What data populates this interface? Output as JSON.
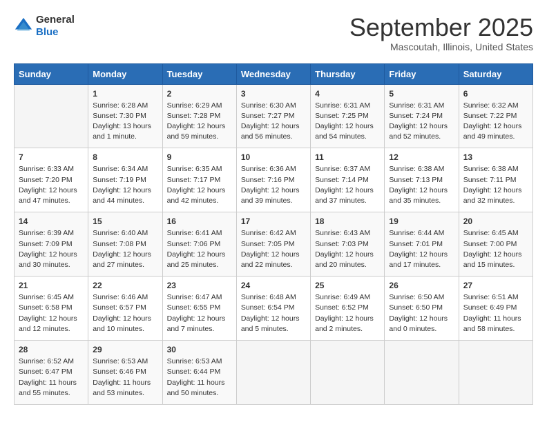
{
  "header": {
    "logo_general": "General",
    "logo_blue": "Blue",
    "month_title": "September 2025",
    "location": "Mascoutah, Illinois, United States"
  },
  "days_of_week": [
    "Sunday",
    "Monday",
    "Tuesday",
    "Wednesday",
    "Thursday",
    "Friday",
    "Saturday"
  ],
  "weeks": [
    [
      {
        "num": "",
        "info": ""
      },
      {
        "num": "1",
        "info": "Sunrise: 6:28 AM\nSunset: 7:30 PM\nDaylight: 13 hours\nand 1 minute."
      },
      {
        "num": "2",
        "info": "Sunrise: 6:29 AM\nSunset: 7:28 PM\nDaylight: 12 hours\nand 59 minutes."
      },
      {
        "num": "3",
        "info": "Sunrise: 6:30 AM\nSunset: 7:27 PM\nDaylight: 12 hours\nand 56 minutes."
      },
      {
        "num": "4",
        "info": "Sunrise: 6:31 AM\nSunset: 7:25 PM\nDaylight: 12 hours\nand 54 minutes."
      },
      {
        "num": "5",
        "info": "Sunrise: 6:31 AM\nSunset: 7:24 PM\nDaylight: 12 hours\nand 52 minutes."
      },
      {
        "num": "6",
        "info": "Sunrise: 6:32 AM\nSunset: 7:22 PM\nDaylight: 12 hours\nand 49 minutes."
      }
    ],
    [
      {
        "num": "7",
        "info": "Sunrise: 6:33 AM\nSunset: 7:20 PM\nDaylight: 12 hours\nand 47 minutes."
      },
      {
        "num": "8",
        "info": "Sunrise: 6:34 AM\nSunset: 7:19 PM\nDaylight: 12 hours\nand 44 minutes."
      },
      {
        "num": "9",
        "info": "Sunrise: 6:35 AM\nSunset: 7:17 PM\nDaylight: 12 hours\nand 42 minutes."
      },
      {
        "num": "10",
        "info": "Sunrise: 6:36 AM\nSunset: 7:16 PM\nDaylight: 12 hours\nand 39 minutes."
      },
      {
        "num": "11",
        "info": "Sunrise: 6:37 AM\nSunset: 7:14 PM\nDaylight: 12 hours\nand 37 minutes."
      },
      {
        "num": "12",
        "info": "Sunrise: 6:38 AM\nSunset: 7:13 PM\nDaylight: 12 hours\nand 35 minutes."
      },
      {
        "num": "13",
        "info": "Sunrise: 6:38 AM\nSunset: 7:11 PM\nDaylight: 12 hours\nand 32 minutes."
      }
    ],
    [
      {
        "num": "14",
        "info": "Sunrise: 6:39 AM\nSunset: 7:09 PM\nDaylight: 12 hours\nand 30 minutes."
      },
      {
        "num": "15",
        "info": "Sunrise: 6:40 AM\nSunset: 7:08 PM\nDaylight: 12 hours\nand 27 minutes."
      },
      {
        "num": "16",
        "info": "Sunrise: 6:41 AM\nSunset: 7:06 PM\nDaylight: 12 hours\nand 25 minutes."
      },
      {
        "num": "17",
        "info": "Sunrise: 6:42 AM\nSunset: 7:05 PM\nDaylight: 12 hours\nand 22 minutes."
      },
      {
        "num": "18",
        "info": "Sunrise: 6:43 AM\nSunset: 7:03 PM\nDaylight: 12 hours\nand 20 minutes."
      },
      {
        "num": "19",
        "info": "Sunrise: 6:44 AM\nSunset: 7:01 PM\nDaylight: 12 hours\nand 17 minutes."
      },
      {
        "num": "20",
        "info": "Sunrise: 6:45 AM\nSunset: 7:00 PM\nDaylight: 12 hours\nand 15 minutes."
      }
    ],
    [
      {
        "num": "21",
        "info": "Sunrise: 6:45 AM\nSunset: 6:58 PM\nDaylight: 12 hours\nand 12 minutes."
      },
      {
        "num": "22",
        "info": "Sunrise: 6:46 AM\nSunset: 6:57 PM\nDaylight: 12 hours\nand 10 minutes."
      },
      {
        "num": "23",
        "info": "Sunrise: 6:47 AM\nSunset: 6:55 PM\nDaylight: 12 hours\nand 7 minutes."
      },
      {
        "num": "24",
        "info": "Sunrise: 6:48 AM\nSunset: 6:54 PM\nDaylight: 12 hours\nand 5 minutes."
      },
      {
        "num": "25",
        "info": "Sunrise: 6:49 AM\nSunset: 6:52 PM\nDaylight: 12 hours\nand 2 minutes."
      },
      {
        "num": "26",
        "info": "Sunrise: 6:50 AM\nSunset: 6:50 PM\nDaylight: 12 hours\nand 0 minutes."
      },
      {
        "num": "27",
        "info": "Sunrise: 6:51 AM\nSunset: 6:49 PM\nDaylight: 11 hours\nand 58 minutes."
      }
    ],
    [
      {
        "num": "28",
        "info": "Sunrise: 6:52 AM\nSunset: 6:47 PM\nDaylight: 11 hours\nand 55 minutes."
      },
      {
        "num": "29",
        "info": "Sunrise: 6:53 AM\nSunset: 6:46 PM\nDaylight: 11 hours\nand 53 minutes."
      },
      {
        "num": "30",
        "info": "Sunrise: 6:53 AM\nSunset: 6:44 PM\nDaylight: 11 hours\nand 50 minutes."
      },
      {
        "num": "",
        "info": ""
      },
      {
        "num": "",
        "info": ""
      },
      {
        "num": "",
        "info": ""
      },
      {
        "num": "",
        "info": ""
      }
    ]
  ]
}
